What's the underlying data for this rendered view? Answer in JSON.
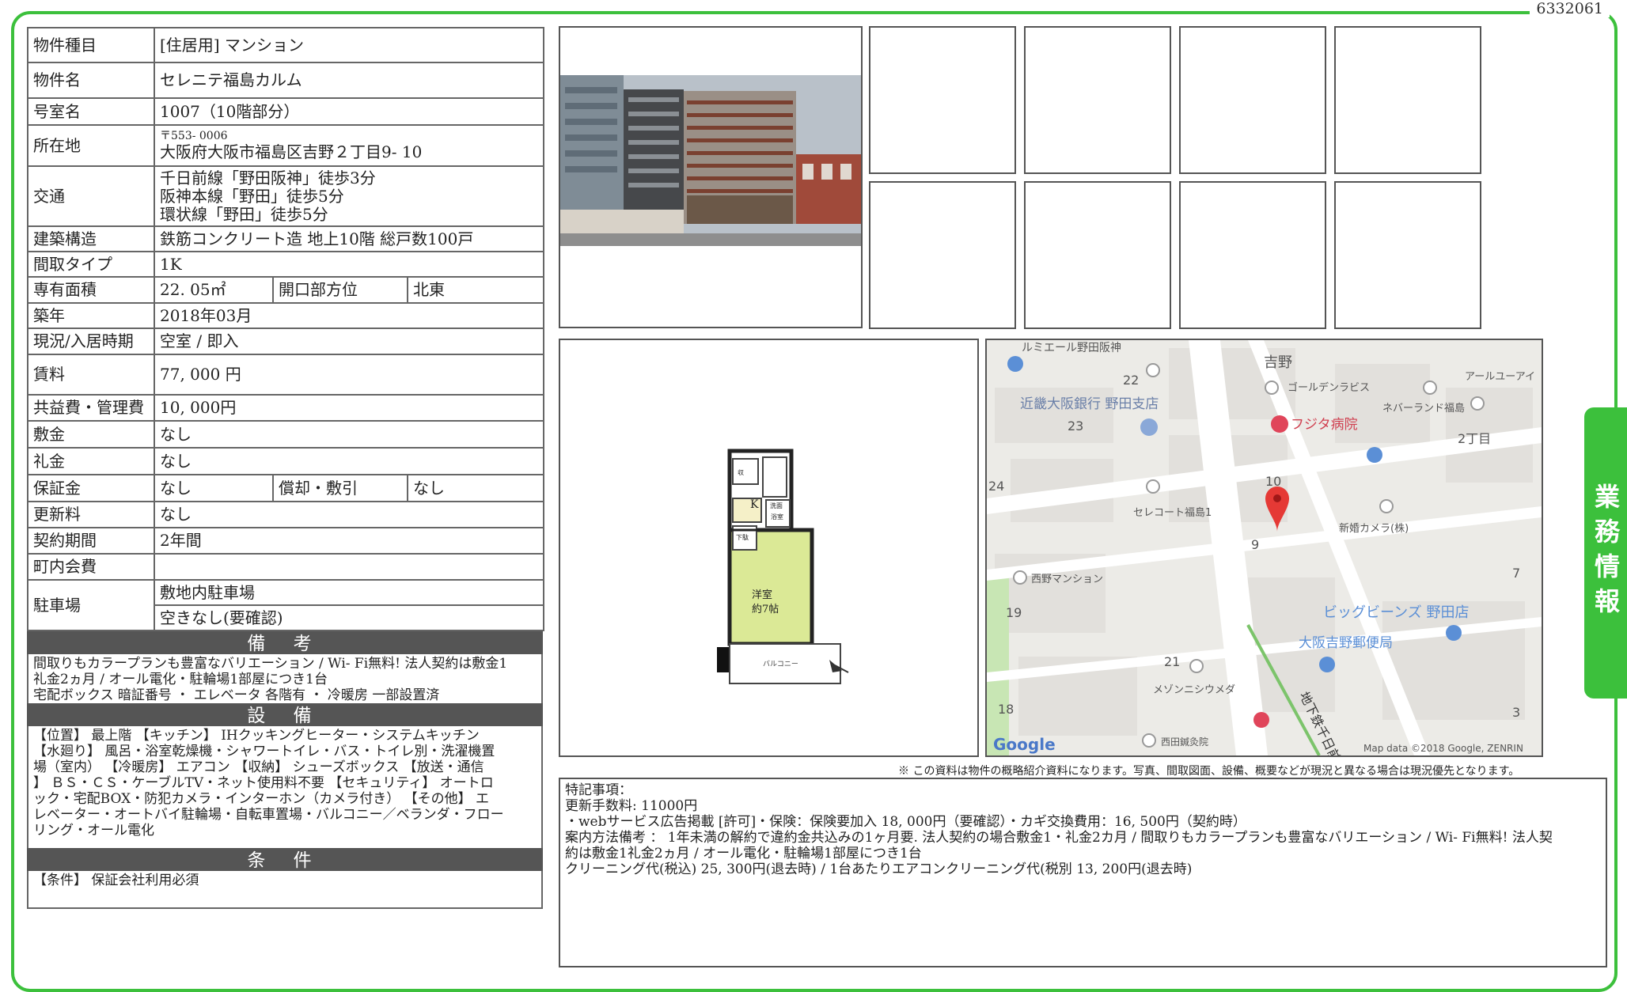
{
  "doc_id": "6332061",
  "side_tab": "業務情報",
  "spec": {
    "type_label": "物件種目",
    "type_value": "[住居用]  マンション",
    "name_label": "物件名",
    "name_value": "セレニテ福島カルム",
    "room_label": "号室名",
    "room_value": "1007（10階部分）",
    "address_label": "所在地",
    "postal": "〒553- 0006",
    "address_value": "大阪府大阪市福島区吉野２丁目9- 10",
    "transport_label": "交通",
    "transport": [
      "千日前線「野田阪神」徒歩3分",
      "阪神本線「野田」徒歩5分",
      "環状線「野田」徒歩5分"
    ],
    "structure_label": "建築構造",
    "structure_value": "鉄筋コンクリート造  地上10階  総戸数100戸",
    "layout_label": "間取タイプ",
    "layout_value": "1K",
    "area_label": "専有面積",
    "area_value": "22. 05㎡",
    "direction_label": "開口部方位",
    "direction_value": "北東",
    "built_label": "築年",
    "built_value": "2018年03月",
    "status_label": "現況/入居時期",
    "status_value": "空室  /  即入",
    "rent_label": "賃料",
    "rent_value": "77, 000  円",
    "fee_label": "共益費・管理費",
    "fee_value": "10, 000円",
    "deposit_label": "敷金",
    "deposit_value": "なし",
    "key_money_label": "礼金",
    "key_money_value": "なし",
    "guarantee_label": "保証金",
    "guarantee_value": "なし",
    "amort_label": "償却・敷引",
    "amort_value": "なし",
    "renewal_label": "更新料",
    "renewal_value": "なし",
    "contract_label": "契約期間",
    "contract_value": "2年間",
    "association_label": "町内会費",
    "association_value": "",
    "parking_label": "駐車場",
    "parking_value": "敷地内駐車場",
    "parking_status": "空きなし(要確認)"
  },
  "notes_title": "備 考",
  "notes": [
    "間取りもカラープランも豊富なバリエーション  /  Wi- Fi無料! 法人契約は敷金1",
    "礼金2ヵ月  /  オール電化・駐輪場1部屋につき1台",
    "宅配ボックス  暗証番号  ・  エレベータ  各階有  ・  冷暖房  一部設置済"
  ],
  "equipment_title": "設 備",
  "equipment": [
    "【位置】  最上階  【キッチン】  IHクッキングヒーター・システムキッチン",
    "【水廻り】  風呂・浴室乾燥機・シャワートイレ・バス・トイレ別・洗濯機置",
    "場（室内）  【冷暖房】  エアコン  【収納】  シューズボックス  【放送・通信",
    "】  ＢＳ・ＣＳ・ケーブルTV・ネット使用料不要  【セキュリティ】  オートロ",
    "ック・宅配BOX・防犯カメラ・インターホン（カメラ付き）  【その他】  エ",
    "レベーター・オートバイ駐輪場・自転車置場・バルコニー／ベランダ・フロー",
    "リング・オール電化"
  ],
  "conditions_title": "条 件",
  "conditions": [
    "【条件】  保証会社利用必須"
  ],
  "floorplan": {
    "room": "洋室",
    "size": "約7帖",
    "kitchen": "K",
    "wash": "洗面",
    "bath": "浴室",
    "storage": "収",
    "shoes": "下駄",
    "balcony": "バルコニー"
  },
  "map": {
    "labels": [
      "ルミエール野田阪神",
      "吉野",
      "アールユーアイ",
      "ゴールデンラビス",
      "ネバーランド福島",
      "近畿大阪銀行 野田支店",
      "フジタ病院",
      "2丁目",
      "セレコート福島1",
      "新婚カメラ(株)",
      "西野マンション",
      "ビッグビーンズ 野田店",
      "大阪吉野郵便局",
      "メゾンニシウメダ",
      "西田鍼灸院",
      "地下鉄千日前線"
    ],
    "numbers": [
      "22",
      "23",
      "24",
      "10",
      "9",
      "7",
      "19",
      "21",
      "18",
      "3"
    ],
    "logo": "Google",
    "attribution": "Map data ©2018 Google, ZENRIN"
  },
  "disclaimer": "※  この資料は物件の概略紹介資料になります。写真、間取図面、設備、概要などが現況と異なる場合は現況優先となります。",
  "remarks": [
    "特記事項：",
    "更新手数料: 11000円",
    "・webサービス広告掲載 [許可]・保険：保険要加入  18, 000円（要確認）・カギ交換費用：16, 500円（契約時）",
    "案内方法備考  ：  1年未満の解約で違約金共込みの1ヶ月要. 法人契約の場合敷金1・礼金2カ月  /  間取りもカラープランも豊富なバリエーション  /  Wi- Fi無料! 法人契",
    "約は敷金1礼金2ヵ月  /  オール電化・駐輪場1部屋につき1台",
    "クリーニング代(税込)  25, 300円(退去時)  /  1台あたりエアコンクリーニング代(税別  13, 200円(退去時)"
  ]
}
